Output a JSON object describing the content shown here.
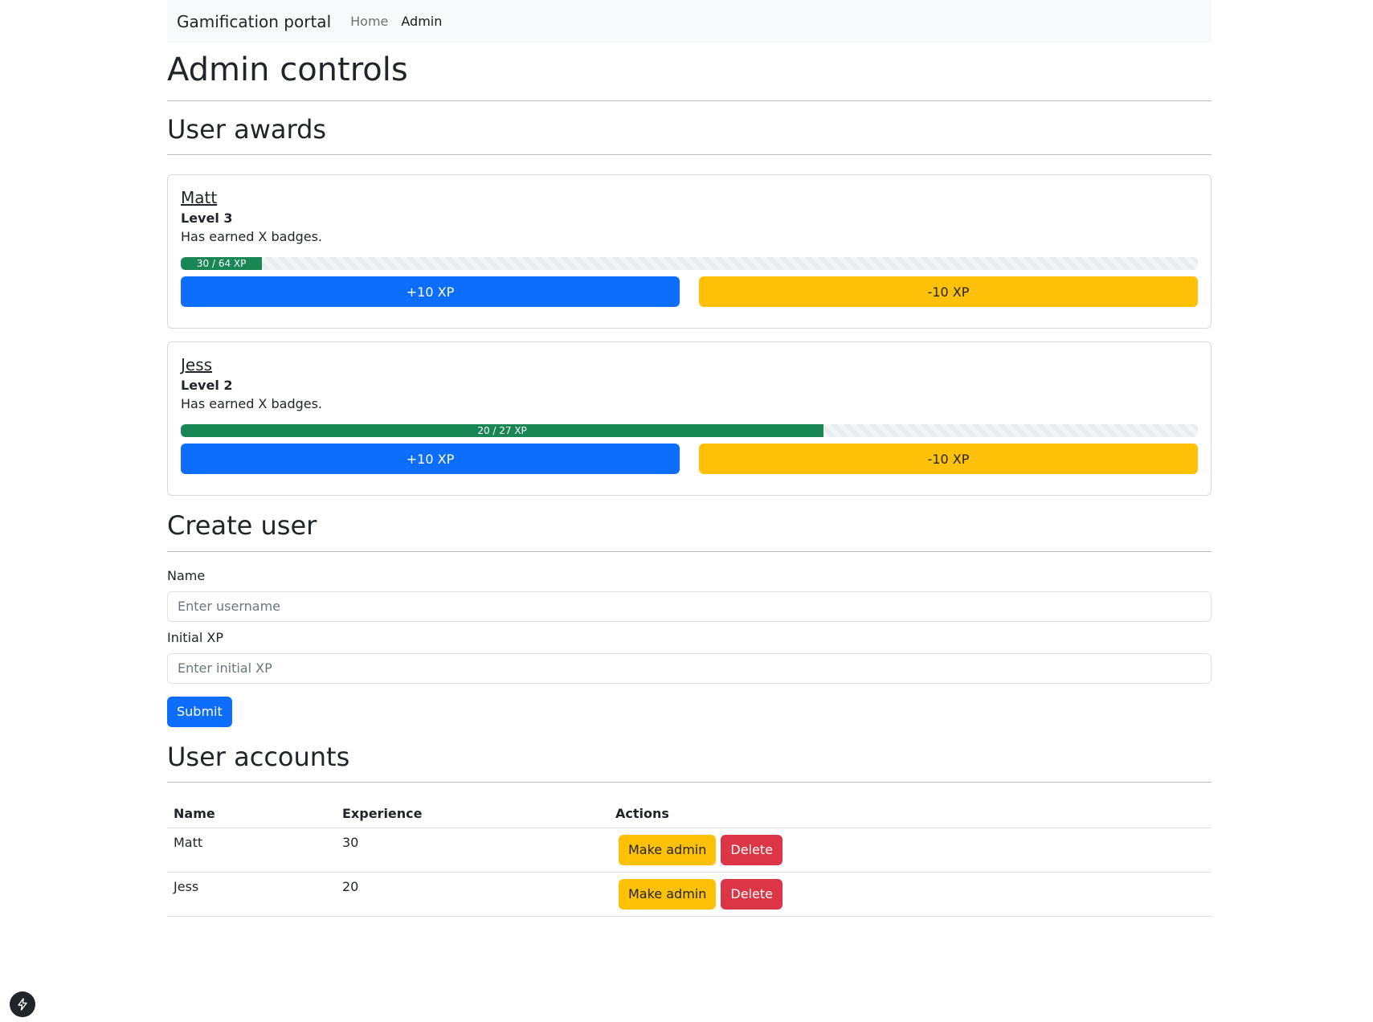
{
  "navbar": {
    "brand": "Gamification portal",
    "links": [
      "Home",
      "Admin"
    ],
    "active": "Admin"
  },
  "page_title": "Admin controls",
  "awards": {
    "title": "User awards",
    "users": [
      {
        "name": "Matt",
        "level": "Level 3",
        "badges": "Has earned X badges.",
        "xp_label": "30 / 64 XP",
        "progress_fraction": 0.08,
        "add_label": "+10 XP",
        "sub_label": "-10 XP"
      },
      {
        "name": "Jess",
        "level": "Level 2",
        "badges": "Has earned X badges.",
        "xp_label": "20 / 27 XP",
        "progress_fraction": 0.632,
        "add_label": "+10 XP",
        "sub_label": "-10 XP"
      }
    ]
  },
  "create_user": {
    "title": "Create user",
    "name_label": "Name",
    "name_placeholder": "Enter username",
    "xp_label": "Initial XP",
    "xp_placeholder": "Enter initial XP",
    "submit_label": "Submit"
  },
  "accounts": {
    "title": "User accounts",
    "headers": [
      "Name",
      "Experience",
      "Actions"
    ],
    "rows": [
      {
        "name": "Matt",
        "experience": "30",
        "make_admin": "Make admin",
        "delete": "Delete"
      },
      {
        "name": "Jess",
        "experience": "20",
        "make_admin": "Make admin",
        "delete": "Delete"
      }
    ]
  },
  "colors": {
    "primary": "#0d6efd",
    "warning": "#ffc107",
    "danger": "#dc3545",
    "success": "#198754"
  },
  "corner_icon": "bolt-icon"
}
